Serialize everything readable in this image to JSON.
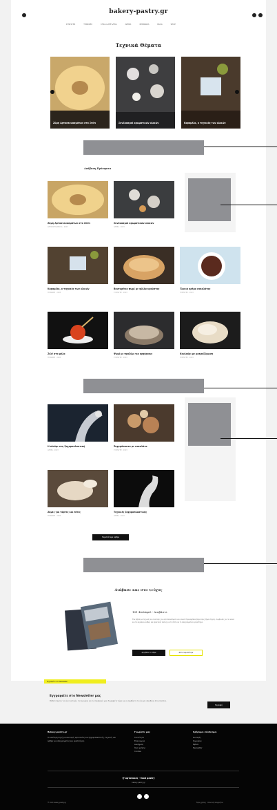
{
  "header": {
    "logo": "bakery-pastry.gr",
    "nav": [
      "ΣΥΝΤΑΓΕΣ",
      "ΤΕΧΝΙΚΕΣ",
      "ΥΛΙΚΑ & ΕΡΓΑΛΕΙΑ",
      "ΑΡΘΡΑ",
      "ΣΕΜΙΝΑΡΙΑ",
      "BLOG",
      "SHOP"
    ]
  },
  "technical": {
    "title": "Τεχνικά Θέματα",
    "items": [
      {
        "caption": "Ζύμη Αρτοσκευασμάτων στο Σπίτι"
      },
      {
        "caption": "Συνδυασμοί αρωματικών υλικών"
      },
      {
        "caption": "Καραμέλα, ο τεχνικός των υλικών"
      }
    ]
  },
  "recipes": {
    "title": "Ανάβαση Πρόσφατα",
    "cards": [
      {
        "title": "Ζύμη Αρτοσκευασμάτων στο Σπίτι",
        "date": "ΑΡΤΟΣΚΕΥΑΣΜΑΤΑ · 2023"
      },
      {
        "title": "Συνδυασμοί αρωματικών υλικών",
        "date": "ΑΡΘΡΑ · 2023"
      },
      {
        "title": "Καραμέλα, ο τεχνικός των υλικών",
        "date": "ΤΕΧΝΙΚΕΣ · 2023"
      },
      {
        "title": "Βουτυρένιο ψωμί με φύλλα κρούστας",
        "date": "ΣΥΝΤΑΓΕΣ · 2023"
      },
      {
        "title": "Γλυκιά κρέμα σοκολάτας",
        "date": "ΣΥΝΤΑΓΕΣ · 2023"
      },
      {
        "title": "Ζελέ στο μήλο",
        "date": "ΤΕΧΝΙΚΕΣ · 2023"
      },
      {
        "title": "Ψωμί με προζύμι για αρχάριους",
        "date": "ΣΥΝΤΑΓΕΣ · 2023"
      },
      {
        "title": "Κουλούρι με μακροζύμωση",
        "date": "ΣΥΝΤΑΓΕΣ · 2023"
      }
    ]
  },
  "more": {
    "cards": [
      {
        "title": "Η αλεύρι στη ζαχαροπλαστική",
        "date": "ΑΡΘΡΑ · 2023"
      },
      {
        "title": "Ζαχαρόπαστα με σοκολάτα",
        "date": "ΣΥΝΤΑΓΕΣ · 2023"
      },
      {
        "title": "Ζύμες για τάρτες και πίτες",
        "date": "ΤΕΧΝΙΚΕΣ · 2023"
      },
      {
        "title": "Τεχνικές ζαχαροπλαστικής",
        "date": "ΑΡΘΡΑ · 2023"
      }
    ],
    "button": "Περισσότερα άρθρα"
  },
  "book": {
    "title": "Διάβασε και στο τεύχος",
    "heading": "101 Φαλάφελ - Διαβάστε",
    "text": "Ένα βιβλίο με τεχνικές και συνταγές για αρτοσκευάσματα και γλυκά. Περιλαμβάνει βήμα προς βήμα οδηγίες, συμβουλές για τα υλικά και τα εργαλεία, καθώς και πρακτικές λύσεις για το σπίτι και το επαγγελματικό εργαστήριο.",
    "btn_primary": "Αγοράστε το τώρα",
    "btn_secondary": "Δείτε περισσότερα"
  },
  "newsletter": {
    "badge": "Εγγραφείτε στο Newsletter",
    "title": "Εγγραφείτε στο Newsletter μας",
    "text": "Μάθετε πρώτοι τις νέες συνταγές, τα σεμινάρια και τις προσφορές μας. Εγγραφείτε τώρα για να λαμβάνετε τα νέα μας απευθείας στο email σας.",
    "button": "Εγγραφή"
  },
  "footer": {
    "col1_title": "Bakery-pastry.gr",
    "col1_text": "Η καλύτερη πηγή για συνταγές αρτοποιίας και ζαχαροπλαστικής, τεχνικές και άρθρα για επαγγελματίες και ερασιτέχνες.",
    "col2_title": "Γνωρίστε μας",
    "col2_items": [
      "Ταυτότητα",
      "Επικοινωνία",
      "Διαφήμιση",
      "Όροι χρήσης",
      "Cookies"
    ],
    "col3_title": "Χρήσιμοι σύνδεσμοι",
    "col3_items": [
      "Συνταγές",
      "Σεμινάρια",
      "Βιβλία",
      "Newsletter"
    ],
    "brand": "@ αρτοποιός · food pastry",
    "brand_sub": "bakery-pastry.gr",
    "copy_left": "© 2023 bakery-pastry.gr",
    "copy_right": "Όροι χρήσης · Πολιτική απορρήτου"
  }
}
